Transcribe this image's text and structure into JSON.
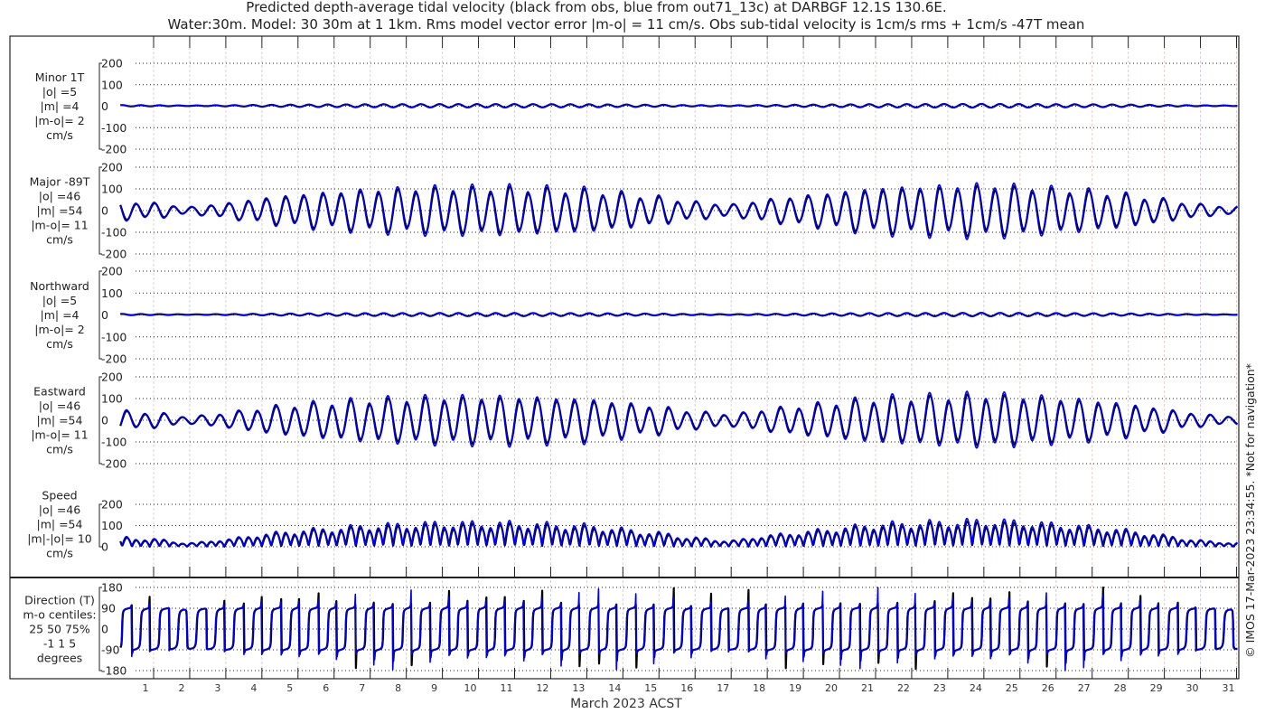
{
  "chart_data": {
    "type": "line",
    "title": "Predicted depth-average tidal velocity (black from obs, blue from out71_13c) at DARBGF 12.1S 130.6E.",
    "subtitle": "Water:30m. Model: 30 30m at 1 1km. Rms model vector error |m-o| = 11 cm/s. Obs sub-tidal velocity is 1cm/s rms + 1cm/s -47T mean",
    "xlabel": "March 2023 ACST",
    "x_ticks": [
      "1",
      "2",
      "3",
      "4",
      "5",
      "6",
      "7",
      "8",
      "9",
      "10",
      "11",
      "12",
      "13",
      "14",
      "15",
      "16",
      "17",
      "18",
      "19",
      "20",
      "21",
      "22",
      "23",
      "24",
      "25",
      "26",
      "27",
      "28",
      "29",
      "30",
      "31"
    ],
    "xlim_days": [
      0.08,
      31.04
    ],
    "grid": true,
    "series_colors": {
      "obs": "#000000",
      "model": "#0000ee"
    },
    "legend": "in title (black = obs, blue = model)",
    "tidal_envelope": {
      "description_units": "cm/s daily major-axis amplitude of observed tide",
      "obs_major_amplitude": [
        40,
        30,
        15,
        30,
        50,
        65,
        75,
        85,
        90,
        95,
        95,
        95,
        90,
        85,
        70,
        55,
        35,
        25,
        45,
        60,
        75,
        90,
        95,
        100,
        105,
        100,
        90,
        80,
        65,
        45,
        25,
        15
      ],
      "model_scale": 1.12,
      "m2_period_days": 0.5175,
      "minor_amplitude_ratio": 0.08
    },
    "panels": [
      {
        "id": "minor",
        "labels": [
          "Minor 1T",
          "|o| =5",
          "|m| =4",
          "|m-o|= 2",
          "cm/s"
        ],
        "ylim": [
          -200,
          200
        ],
        "yticks": [
          "200",
          "100",
          "0",
          "-100",
          "-200"
        ],
        "ytick_values": [
          200,
          100,
          0,
          -100,
          -200
        ]
      },
      {
        "id": "major",
        "labels": [
          "Major -89T",
          "|o| =46",
          "|m| =54",
          "|m-o|= 11",
          "cm/s"
        ],
        "ylim": [
          -200,
          200
        ],
        "yticks": [
          "200",
          "100",
          "0",
          "-100",
          "-200"
        ],
        "ytick_values": [
          200,
          100,
          0,
          -100,
          -200
        ]
      },
      {
        "id": "northward",
        "labels": [
          "Northward",
          "|o| =5",
          "|m| =4",
          "|m-o|= 2",
          "cm/s"
        ],
        "ylim": [
          -200,
          200
        ],
        "yticks": [
          "200",
          "100",
          "0",
          "-100",
          "-200"
        ],
        "ytick_values": [
          200,
          100,
          0,
          -100,
          -200
        ]
      },
      {
        "id": "eastward",
        "labels": [
          "Eastward",
          "|o| =46",
          "|m| =54",
          "|m-o|= 11",
          "cm/s"
        ],
        "ylim": [
          -200,
          200
        ],
        "yticks": [
          "200",
          "100",
          "0",
          "-100",
          "-200"
        ],
        "ytick_values": [
          200,
          100,
          0,
          -100,
          -200
        ]
      },
      {
        "id": "speed",
        "labels": [
          "Speed",
          "|o| =46",
          "|m| =54",
          "|m|-|o|= 10",
          "cm/s"
        ],
        "ylim": [
          0,
          200
        ],
        "yticks": [
          "200",
          "100",
          "0"
        ],
        "ytick_values": [
          200,
          100,
          0
        ]
      },
      {
        "id": "direction",
        "labels": [
          "Direction (T)",
          "m-o centiles:",
          "25  50  75%",
          "-1  1  5",
          "degrees"
        ],
        "ylim": [
          -180,
          180
        ],
        "yticks": [
          "180",
          "90",
          "0",
          "-90",
          "-180"
        ],
        "ytick_values": [
          180,
          90,
          0,
          -90,
          -180
        ]
      }
    ],
    "copyright": "© IMOS 17-Mar-2023 23:34:55. *Not for navigation*"
  }
}
